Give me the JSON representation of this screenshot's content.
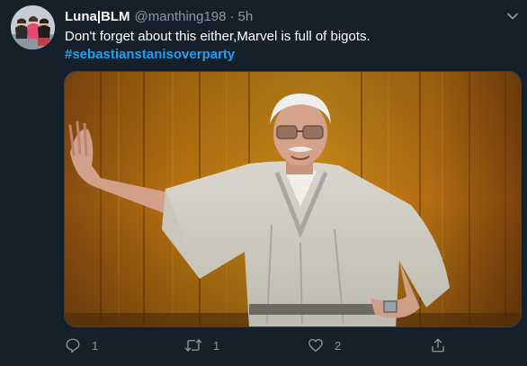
{
  "tweet": {
    "display_name": "Luna|BLM",
    "handle": "@manthing198",
    "separator": "·",
    "time": "5h",
    "text": "Don't forget about this either,Marvel is full of bigots.",
    "hashtag": "#sebastianstanisoverparty"
  },
  "media": {
    "subject": "Photo of an elderly man in a light robe posing against a wooden wall"
  },
  "actions": {
    "reply_count": "1",
    "retweet_count": "1",
    "like_count": "2"
  },
  "icons": {
    "more": "chevron-down-icon",
    "reply": "reply-icon",
    "retweet": "retweet-icon",
    "like": "heart-icon",
    "share": "share-icon"
  },
  "colors": {
    "background": "#15202b",
    "text": "#ffffff",
    "muted": "#8899a6",
    "link": "#1da1f2"
  }
}
